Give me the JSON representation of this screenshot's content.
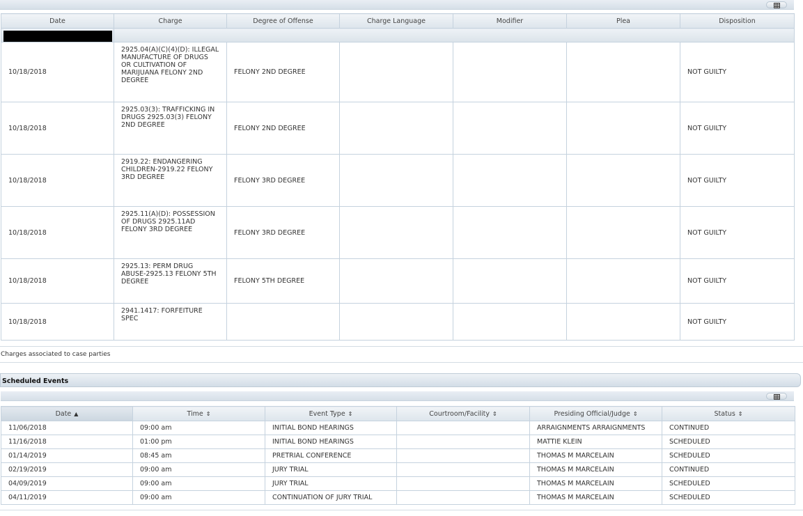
{
  "charges": {
    "columns": [
      "Date",
      "Charge",
      "Degree of Offense",
      "Charge Language",
      "Modifier",
      "Plea",
      "Disposition"
    ],
    "rows": [
      {
        "date": "10/18/2018",
        "charge": "2925.04(A)(C)(4)(D): ILLEGAL MANUFACTURE OF DRUGS OR CULTIVATION OF MARIJUANA FELONY 2ND DEGREE",
        "degree": "FELONY 2ND DEGREE",
        "language": "",
        "modifier": "",
        "plea": "",
        "disposition": "NOT GUILTY"
      },
      {
        "date": "10/18/2018",
        "charge": "2925.03(3): TRAFFICKING IN DRUGS 2925.03(3) FELONY 2ND DEGREE",
        "degree": "FELONY 2ND DEGREE",
        "language": "",
        "modifier": "",
        "plea": "",
        "disposition": "NOT GUILTY"
      },
      {
        "date": "10/18/2018",
        "charge": "2919.22: ENDANGERING CHILDREN-2919.22 FELONY 3RD DEGREE",
        "degree": "FELONY 3RD DEGREE",
        "language": "",
        "modifier": "",
        "plea": "",
        "disposition": "NOT GUILTY"
      },
      {
        "date": "10/18/2018",
        "charge": "2925.11(A)(D): POSSESSION OF DRUGS 2925.11AD FELONY 3RD DEGREE",
        "degree": "FELONY 3RD DEGREE",
        "language": "",
        "modifier": "",
        "plea": "",
        "disposition": "NOT GUILTY"
      },
      {
        "date": "10/18/2018",
        "charge": "2925.13: PERM DRUG ABUSE-2925.13 FELONY 5TH DEGREE",
        "degree": "FELONY 5TH DEGREE",
        "language": "",
        "modifier": "",
        "plea": "",
        "disposition": "NOT GUILTY"
      },
      {
        "date": "10/18/2018",
        "charge": "2941.1417: FORFEITURE SPEC",
        "degree": "",
        "language": "",
        "modifier": "",
        "plea": "",
        "disposition": "NOT GUILTY"
      }
    ],
    "note": "Charges associated to case parties"
  },
  "events": {
    "title": "Scheduled Events",
    "columns": [
      "Date",
      "Time",
      "Event Type",
      "Courtroom/Facility",
      "Presiding Official/Judge",
      "Status"
    ],
    "sort_ascending_glyph": "▲",
    "sortable_glyph": "⇕",
    "rows": [
      {
        "date": "11/06/2018",
        "time": "09:00 am",
        "type": "INITIAL BOND HEARINGS",
        "room": "",
        "judge": "ARRAIGNMENTS ARRAIGNMENTS",
        "status": "CONTINUED"
      },
      {
        "date": "11/16/2018",
        "time": "01:00 pm",
        "type": "INITIAL BOND HEARINGS",
        "room": "",
        "judge": "MATTIE KLEIN",
        "status": "SCHEDULED"
      },
      {
        "date": "01/14/2019",
        "time": "08:45 am",
        "type": "PRETRIAL CONFERENCE",
        "room": "",
        "judge": "THOMAS M MARCELAIN",
        "status": "SCHEDULED"
      },
      {
        "date": "02/19/2019",
        "time": "09:00 am",
        "type": "JURY TRIAL",
        "room": "",
        "judge": "THOMAS M MARCELAIN",
        "status": "CONTINUED"
      },
      {
        "date": "04/09/2019",
        "time": "09:00 am",
        "type": "JURY TRIAL",
        "room": "",
        "judge": "THOMAS M MARCELAIN",
        "status": "SCHEDULED"
      },
      {
        "date": "04/11/2019",
        "time": "09:00 am",
        "type": "CONTINUATION OF JURY TRIAL",
        "room": "",
        "judge": "THOMAS M MARCELAIN",
        "status": "SCHEDULED"
      }
    ]
  }
}
